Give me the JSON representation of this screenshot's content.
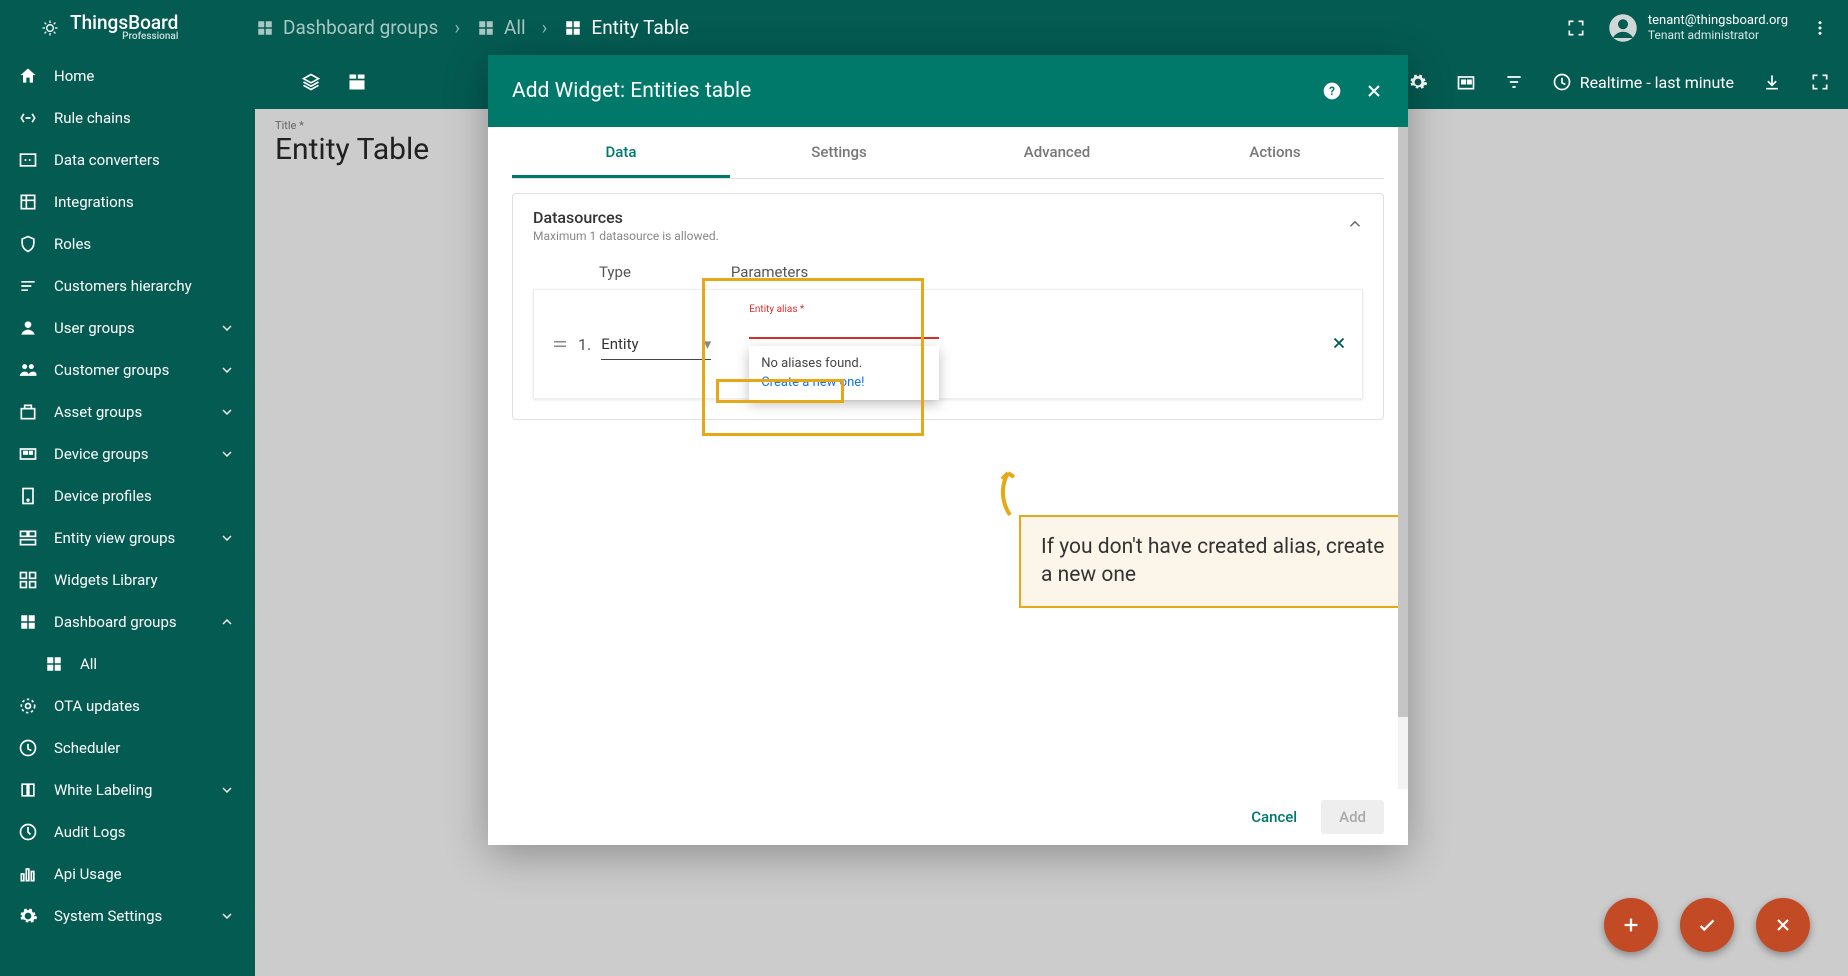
{
  "app": {
    "name": "ThingsBoard",
    "edition": "Professional"
  },
  "breadcrumb": [
    {
      "label": "Dashboard groups"
    },
    {
      "label": "All"
    },
    {
      "label": "Entity Table"
    }
  ],
  "user": {
    "email": "tenant@thingsboard.org",
    "role": "Tenant administrator"
  },
  "sidebar": [
    {
      "icon": "home",
      "label": "Home"
    },
    {
      "icon": "rules",
      "label": "Rule chains"
    },
    {
      "icon": "converters",
      "label": "Data converters"
    },
    {
      "icon": "integrations",
      "label": "Integrations"
    },
    {
      "icon": "roles",
      "label": "Roles"
    },
    {
      "icon": "hierarchy",
      "label": "Customers hierarchy"
    },
    {
      "icon": "usergroups",
      "label": "User groups",
      "expandable": true
    },
    {
      "icon": "customergroups",
      "label": "Customer groups",
      "expandable": true
    },
    {
      "icon": "asset",
      "label": "Asset groups",
      "expandable": true
    },
    {
      "icon": "device",
      "label": "Device groups",
      "expandable": true
    },
    {
      "icon": "profiles",
      "label": "Device profiles"
    },
    {
      "icon": "entityview",
      "label": "Entity view groups",
      "expandable": true
    },
    {
      "icon": "widgets",
      "label": "Widgets Library"
    },
    {
      "icon": "dashboards",
      "label": "Dashboard groups",
      "expandable": true,
      "expanded": true
    },
    {
      "icon": "dashboards",
      "label": "All",
      "sub": true
    },
    {
      "icon": "ota",
      "label": "OTA updates"
    },
    {
      "icon": "scheduler",
      "label": "Scheduler"
    },
    {
      "icon": "labeling",
      "label": "White Labeling",
      "expandable": true
    },
    {
      "icon": "audit",
      "label": "Audit Logs"
    },
    {
      "icon": "api",
      "label": "Api Usage"
    },
    {
      "icon": "settings",
      "label": "System Settings",
      "expandable": true
    }
  ],
  "toolbar": {
    "realtime": "Realtime - last minute"
  },
  "page": {
    "title_label": "Title *",
    "title": "Entity Table"
  },
  "modal": {
    "title": "Add Widget: Entities table",
    "tabs": [
      "Data",
      "Settings",
      "Advanced",
      "Actions"
    ],
    "active_tab": 0,
    "card": {
      "title": "Datasources",
      "subtitle": "Maximum 1 datasource is allowed.",
      "col_type": "Type",
      "col_params": "Parameters",
      "row": {
        "index": "1.",
        "type_value": "Entity",
        "alias_label": "Entity alias *",
        "alias_value": "",
        "dropdown_msg": "No aliases found.",
        "dropdown_link": "Create a new one!"
      }
    },
    "callout": "If you don't have created alias, create a new one",
    "buttons": {
      "cancel": "Cancel",
      "add": "Add"
    }
  }
}
